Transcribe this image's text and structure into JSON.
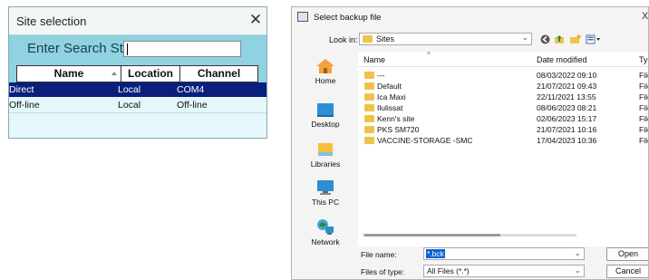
{
  "site_dialog": {
    "title": "Site selection",
    "close_glyph": "✕",
    "search_label": "Enter Search St...",
    "search_value": "",
    "columns": [
      "Name",
      "Location",
      "Channel"
    ],
    "rows": [
      {
        "name": "Direct",
        "location": "Local",
        "channel": "COM4",
        "selected": true
      },
      {
        "name": "Off-line",
        "location": "Local",
        "channel": "Off-line",
        "selected": false
      }
    ]
  },
  "backup_dialog": {
    "title": "Select backup file",
    "close_glyph": "X",
    "look_in_label": "Look in:",
    "look_in_value": "Sites",
    "toolbar_icons": [
      "back-icon",
      "up-folder-icon",
      "new-folder-icon",
      "view-menu-icon"
    ],
    "places": [
      {
        "label": "Home",
        "icon": "home-icon"
      },
      {
        "label": "Desktop",
        "icon": "desktop-icon"
      },
      {
        "label": "Libraries",
        "icon": "libraries-icon"
      },
      {
        "label": "This PC",
        "icon": "this-pc-icon"
      },
      {
        "label": "Network",
        "icon": "network-icon"
      }
    ],
    "columns": {
      "name": "Name",
      "date": "Date modified",
      "type": "Typ"
    },
    "files": [
      {
        "name": "---",
        "date": "08/03/2022 09:10",
        "type": "File"
      },
      {
        "name": "Default",
        "date": "21/07/2021 09:43",
        "type": "File"
      },
      {
        "name": "Ica Maxi",
        "date": "22/11/2021 13:55",
        "type": "File"
      },
      {
        "name": "Ilulissat",
        "date": "08/06/2023 08:21",
        "type": "File"
      },
      {
        "name": "Kenn's site",
        "date": "02/06/2023 15:17",
        "type": "File"
      },
      {
        "name": "PKS SM720",
        "date": "21/07/2021 10:16",
        "type": "File"
      },
      {
        "name": "VACCINE-STORAGE -SMC",
        "date": "17/04/2023 10:36",
        "type": "File"
      }
    ],
    "file_name_label": "File name:",
    "file_name_value": "*.bck",
    "files_of_type_label": "Files of type:",
    "files_of_type_value": "All Files (*.*)",
    "open_label": "Open",
    "cancel_label": "Cancel"
  },
  "colors": {
    "site_bg": "#8fd2e1",
    "selection": "#0a1f7c",
    "folder": "#f1c34b"
  }
}
